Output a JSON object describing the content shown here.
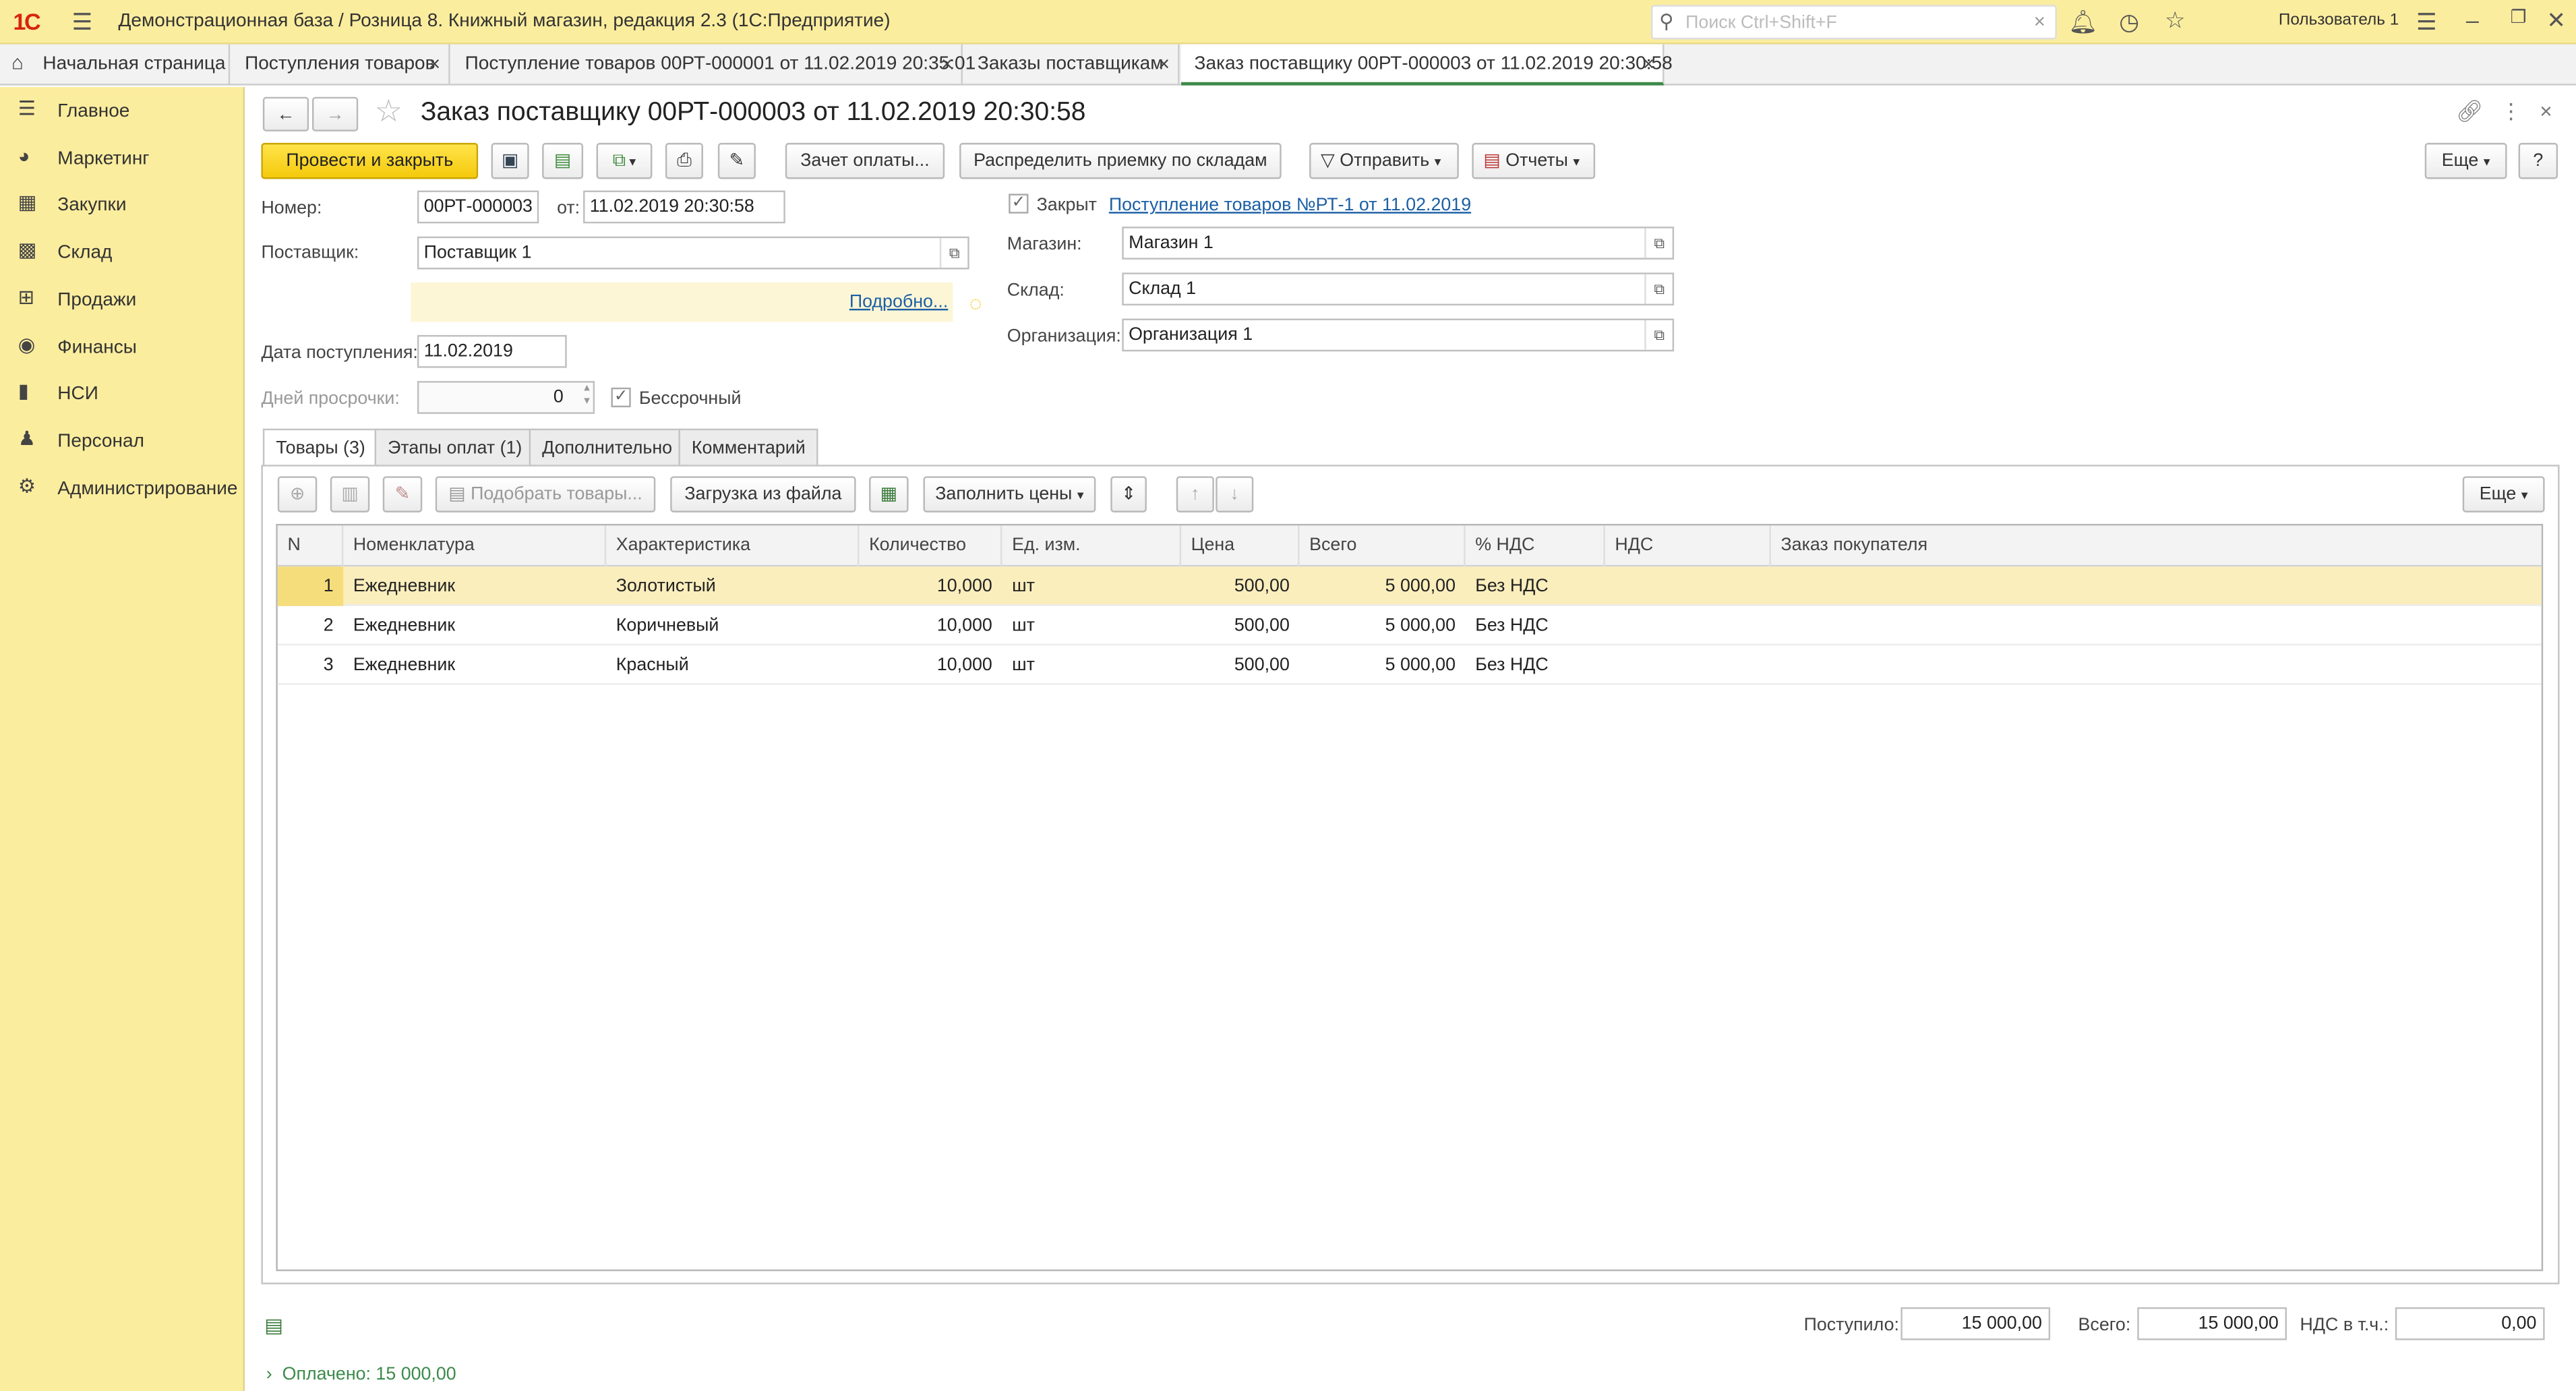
{
  "window": {
    "logo": "1С",
    "title": "Демонстрационная база / Розница 8. Книжный магазин, редакция 2.3  (1С:Предприятие)",
    "search_placeholder": "Поиск Ctrl+Shift+F",
    "user": "Пользователь 1"
  },
  "tabs": [
    {
      "label": "Начальная страница"
    },
    {
      "label": "Поступления товаров"
    },
    {
      "label": "Поступление товаров 00РТ-000001 от 11.02.2019 20:35:01"
    },
    {
      "label": "Заказы поставщикам"
    },
    {
      "label": "Заказ поставщику 00РТ-000003 от 11.02.2019 20:30:58"
    }
  ],
  "sidebar": {
    "items": [
      {
        "label": "Главное",
        "icon": "menu-icon"
      },
      {
        "label": "Маркетинг",
        "icon": "pie-chart-icon"
      },
      {
        "label": "Закупки",
        "icon": "cart-icon"
      },
      {
        "label": "Склад",
        "icon": "warehouse-icon"
      },
      {
        "label": "Продажи",
        "icon": "basket-icon"
      },
      {
        "label": "Финансы",
        "icon": "coin-icon"
      },
      {
        "label": "НСИ",
        "icon": "book-icon"
      },
      {
        "label": "Персонал",
        "icon": "person-icon"
      },
      {
        "label": "Администрирование",
        "icon": "gear-icon"
      }
    ]
  },
  "form": {
    "title": "Заказ поставщику 00РТ-000003 от 11.02.2019 20:30:58",
    "toolbar": {
      "post_close": "Провести и закрыть",
      "offset_payment": "Зачет оплаты...",
      "distribute": "Распределить приемку по складам",
      "send": "Отправить",
      "reports": "Отчеты",
      "more": "Еще",
      "help": "?"
    },
    "number_label": "Номер:",
    "number_value": "00РТ-000003",
    "from_label": "от:",
    "date_value": "11.02.2019 20:30:58",
    "closed_label": "Закрыт",
    "closed_link": "Поступление товаров №РТ-1 от 11.02.2019",
    "supplier_label": "Поставщик:",
    "supplier_value": "Поставщик 1",
    "details_link": "Подробно...",
    "store_label": "Магазин:",
    "store_value": "Магазин 1",
    "warehouse_label": "Склад:",
    "warehouse_value": "Склад 1",
    "org_label": "Организация:",
    "org_value": "Организация 1",
    "receipt_date_label": "Дата поступления:",
    "receipt_date_value": "11.02.2019",
    "overdue_label": "Дней просрочки:",
    "overdue_value": "0",
    "indefinite_label": "Бессрочный"
  },
  "form_tabs": [
    {
      "label": "Товары (3)"
    },
    {
      "label": "Этапы оплат (1)"
    },
    {
      "label": "Дополнительно"
    },
    {
      "label": "Комментарий"
    }
  ],
  "table_toolbar": {
    "pick_goods": "Подобрать товары...",
    "load_file": "Загрузка из файла",
    "fill_prices": "Заполнить цены",
    "more": "Еще"
  },
  "table": {
    "columns": [
      "N",
      "Номенклатура",
      "Характеристика",
      "Количество",
      "Ед. изм.",
      "Цена",
      "Всего",
      "% НДС",
      "НДС",
      "Заказ покупателя"
    ],
    "rows": [
      {
        "n": "1",
        "item": "Ежедневник",
        "feature": "Золотистый",
        "qty": "10,000",
        "unit": "шт",
        "price": "500,00",
        "total": "5 000,00",
        "vat_rate": "Без НДС",
        "vat": "",
        "order": ""
      },
      {
        "n": "2",
        "item": "Ежедневник",
        "feature": "Коричневый",
        "qty": "10,000",
        "unit": "шт",
        "price": "500,00",
        "total": "5 000,00",
        "vat_rate": "Без НДС",
        "vat": "",
        "order": ""
      },
      {
        "n": "3",
        "item": "Ежедневник",
        "feature": "Красный",
        "qty": "10,000",
        "unit": "шт",
        "price": "500,00",
        "total": "5 000,00",
        "vat_rate": "Без НДС",
        "vat": "",
        "order": ""
      }
    ]
  },
  "totals": {
    "received_label": "Поступило:",
    "received_value": "15 000,00",
    "total_label": "Всего:",
    "total_value": "15 000,00",
    "vat_label": "НДС в т.ч.:",
    "vat_value": "0,00",
    "paid_label": "Оплачено: 15 000,00"
  },
  "colors": {
    "panel": "#fbed9e",
    "primary_button": "#f5c90c",
    "selected_row": "#fbeebd",
    "link": "#1c5fa5",
    "paid": "#3c8a4a"
  }
}
